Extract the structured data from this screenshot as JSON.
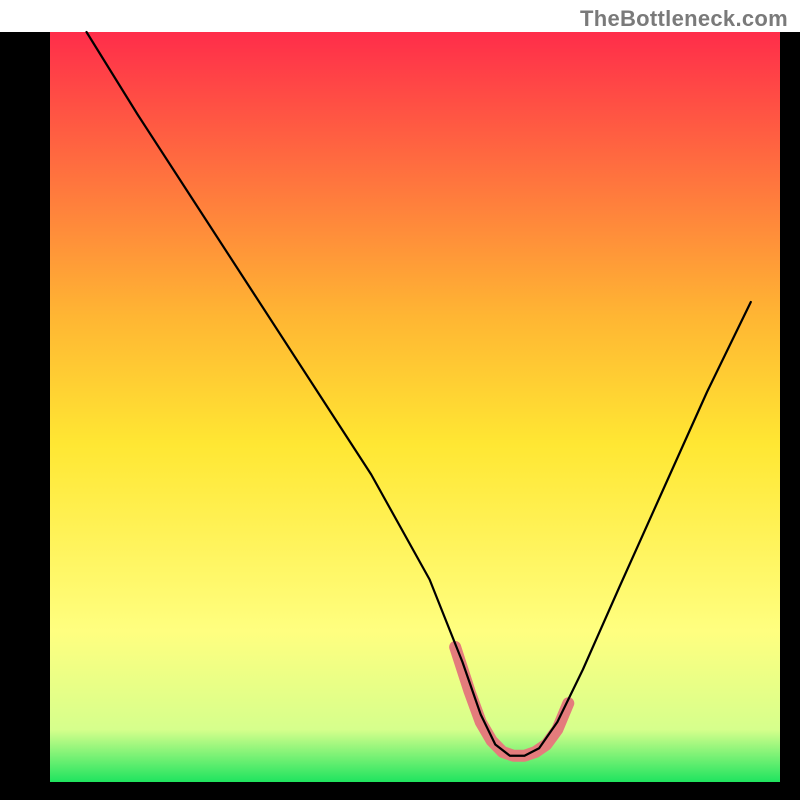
{
  "watermark": "TheBottleneck.com",
  "chart_data": {
    "type": "line",
    "title": "",
    "xlabel": "",
    "ylabel": "",
    "xlim": [
      0,
      100
    ],
    "ylim": [
      0,
      100
    ],
    "background": {
      "gradient_stops": [
        {
          "offset": 0,
          "color": "#ff2d4a"
        },
        {
          "offset": 0.38,
          "color": "#ffb633"
        },
        {
          "offset": 0.55,
          "color": "#ffe733"
        },
        {
          "offset": 0.8,
          "color": "#ffff80"
        },
        {
          "offset": 0.93,
          "color": "#d6ff8c"
        },
        {
          "offset": 1.0,
          "color": "#1fe45f"
        }
      ]
    },
    "series": [
      {
        "name": "bottleneck-curve",
        "color": "#000000",
        "stroke_width": 2.2,
        "x": [
          5,
          12,
          20,
          28,
          36,
          44,
          52,
          56.5,
          59,
          61,
          63,
          65,
          67,
          69.5,
          73,
          78,
          84,
          90,
          96
        ],
        "y": [
          100,
          89,
          77,
          65,
          53,
          41,
          27,
          16,
          9,
          5,
          3.5,
          3.5,
          4.5,
          8,
          15,
          26,
          39,
          52,
          64
        ]
      }
    ],
    "highlight": {
      "name": "recommended-range",
      "color": "#e47c7c",
      "stroke_width": 12,
      "x": [
        55.5,
        57.5,
        59,
        60.5,
        62,
        63.5,
        65,
        66.5,
        68,
        69.5,
        71
      ],
      "y": [
        18,
        12,
        8,
        5.5,
        4,
        3.5,
        3.5,
        4,
        5,
        7,
        10.5
      ]
    },
    "plot_frame": {
      "left_border_color": "#000000",
      "bottom_border_color": "#000000",
      "right_border_color": "#000000",
      "border_width_left": 50,
      "border_width_right": 20,
      "border_width_bottom": 18
    }
  }
}
